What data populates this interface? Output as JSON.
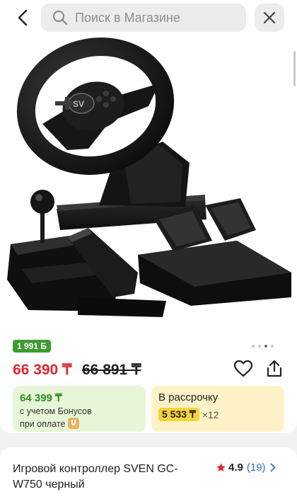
{
  "header": {
    "search_placeholder": "Поиск в Магазине"
  },
  "product": {
    "bonus_badge": "1 991 Б",
    "price": "66 390 ₸",
    "old_price": "66 891 ₸",
    "gallery": {
      "total": 4,
      "active_index": 3
    },
    "bonus_price": {
      "amount": "64 399 ₸",
      "line1": "с учетом Бонусов",
      "line2": "при оплате"
    },
    "installment": {
      "title": "В рассрочку",
      "amount": "5 533 ₸",
      "multiplier": "×12"
    },
    "name": "Игровой контроллер SVEN GC-W750 черный",
    "rating": "4.9",
    "reviews_count": "(19)"
  },
  "colors": {
    "price_red": "#e0262d",
    "bonus_green": "#3e9b2f",
    "installment_yellow": "#f7d23a",
    "star": "#e0262d",
    "link_blue": "#2b73c7"
  },
  "icons": [
    "back-arrow-icon",
    "search-icon",
    "close-icon",
    "heart-icon",
    "share-icon",
    "star-icon",
    "chevron-right-icon",
    "bonus-coin-icon"
  ]
}
